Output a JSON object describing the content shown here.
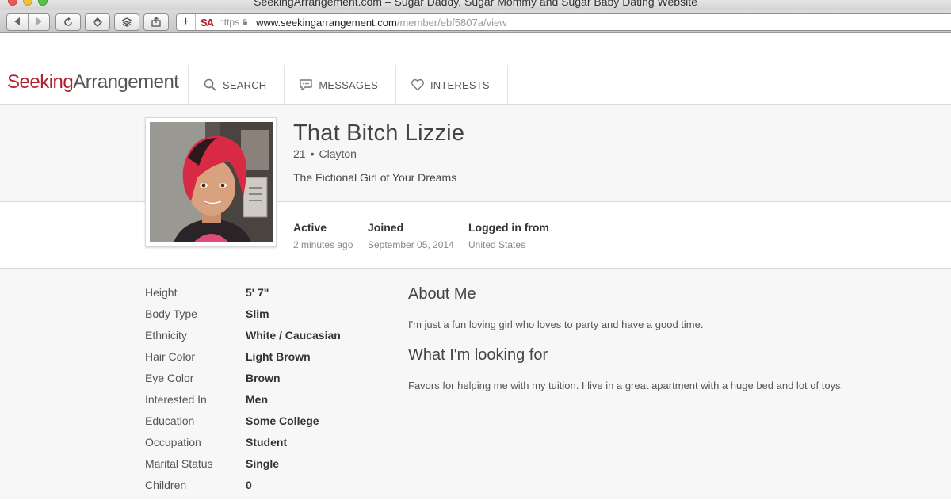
{
  "browser": {
    "window_title": "SeekingArrangement.com – Sugar Daddy, Sugar Mommy and Sugar Baby Dating Website",
    "scheme": "https",
    "url_host": "www.seekingarrangement.com",
    "url_path": "/member/ebf5807a/view",
    "favicon_text": "SA"
  },
  "site": {
    "logo_part1": "Seeking",
    "logo_part2": "Arrangement",
    "nav": [
      {
        "label": "SEARCH",
        "icon": "search-icon"
      },
      {
        "label": "MESSAGES",
        "icon": "chat-bubble-icon"
      },
      {
        "label": "INTERESTS",
        "icon": "heart-icon"
      }
    ]
  },
  "profile": {
    "name": "That Bitch Lizzie",
    "age": "21",
    "location": "Clayton",
    "headline": "The Fictional Girl of Your Dreams",
    "stats": [
      {
        "label": "Active",
        "value": "2 minutes ago"
      },
      {
        "label": "Joined",
        "value": "September 05, 2014"
      },
      {
        "label": "Logged in from",
        "value": "United States"
      }
    ],
    "details": [
      {
        "key": "Height",
        "value": "5' 7\""
      },
      {
        "key": "Body Type",
        "value": "Slim"
      },
      {
        "key": "Ethnicity",
        "value": "White / Caucasian"
      },
      {
        "key": "Hair Color",
        "value": "Light Brown"
      },
      {
        "key": "Eye Color",
        "value": "Brown"
      },
      {
        "key": "Interested In",
        "value": "Men"
      },
      {
        "key": "Education",
        "value": "Some College"
      },
      {
        "key": "Occupation",
        "value": "Student"
      },
      {
        "key": "Marital Status",
        "value": "Single"
      },
      {
        "key": "Children",
        "value": "0"
      }
    ],
    "about_title": "About Me",
    "about_text": "I'm just a fun loving girl who loves to party and have a good time.",
    "looking_title": "What I'm looking for",
    "looking_text": "Favors for helping me with my tuition. I live in a great apartment with a huge bed and lot of toys."
  },
  "colors": {
    "brand_red": "#b21f2d",
    "band_gray": "#f7f7f7"
  }
}
